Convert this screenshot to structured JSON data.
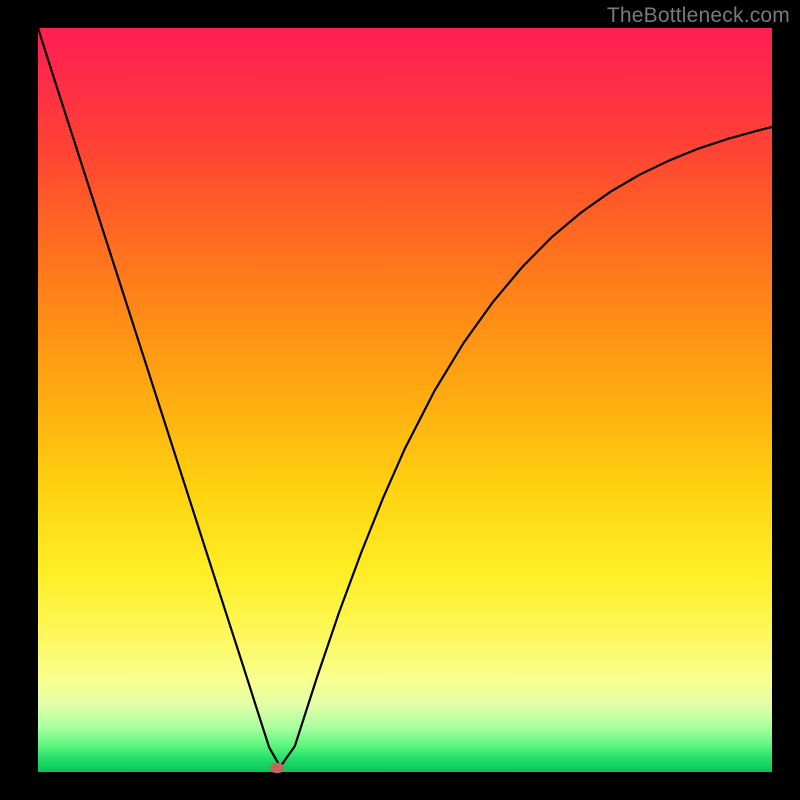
{
  "watermark": "TheBottleneck.com",
  "colors": {
    "curve": "#000000",
    "marker": "#c1675d",
    "frame": "#000000"
  },
  "chart_data": {
    "type": "line",
    "title": "",
    "xlabel": "",
    "ylabel": "",
    "xlim": [
      0,
      100
    ],
    "ylim": [
      0,
      100
    ],
    "grid": false,
    "legend": false,
    "annotations": [],
    "series": [
      {
        "name": "bottleneck-curve",
        "x": [
          0,
          2,
          5,
          8,
          11,
          14,
          17,
          20,
          23,
          26,
          28,
          30,
          31.5,
          33,
          35,
          38,
          41,
          44,
          47,
          50,
          54,
          58,
          62,
          66,
          70,
          74,
          78,
          82,
          86,
          90,
          94,
          98,
          100
        ],
        "y": [
          100,
          93.8,
          84.6,
          75.4,
          66.2,
          57.0,
          47.8,
          38.6,
          29.4,
          20.2,
          14.1,
          7.9,
          3.3,
          0.7,
          3.5,
          12.7,
          21.4,
          29.4,
          36.8,
          43.5,
          51.2,
          57.7,
          63.2,
          67.9,
          71.9,
          75.2,
          78.0,
          80.3,
          82.2,
          83.8,
          85.1,
          86.2,
          86.7
        ]
      }
    ],
    "marker": {
      "x": 32.5,
      "y": 0.6
    },
    "background_gradient": {
      "top": "#ff1f53",
      "mid1": "#ff8f15",
      "mid2": "#ffee25",
      "bottom": "#0bc257"
    }
  }
}
